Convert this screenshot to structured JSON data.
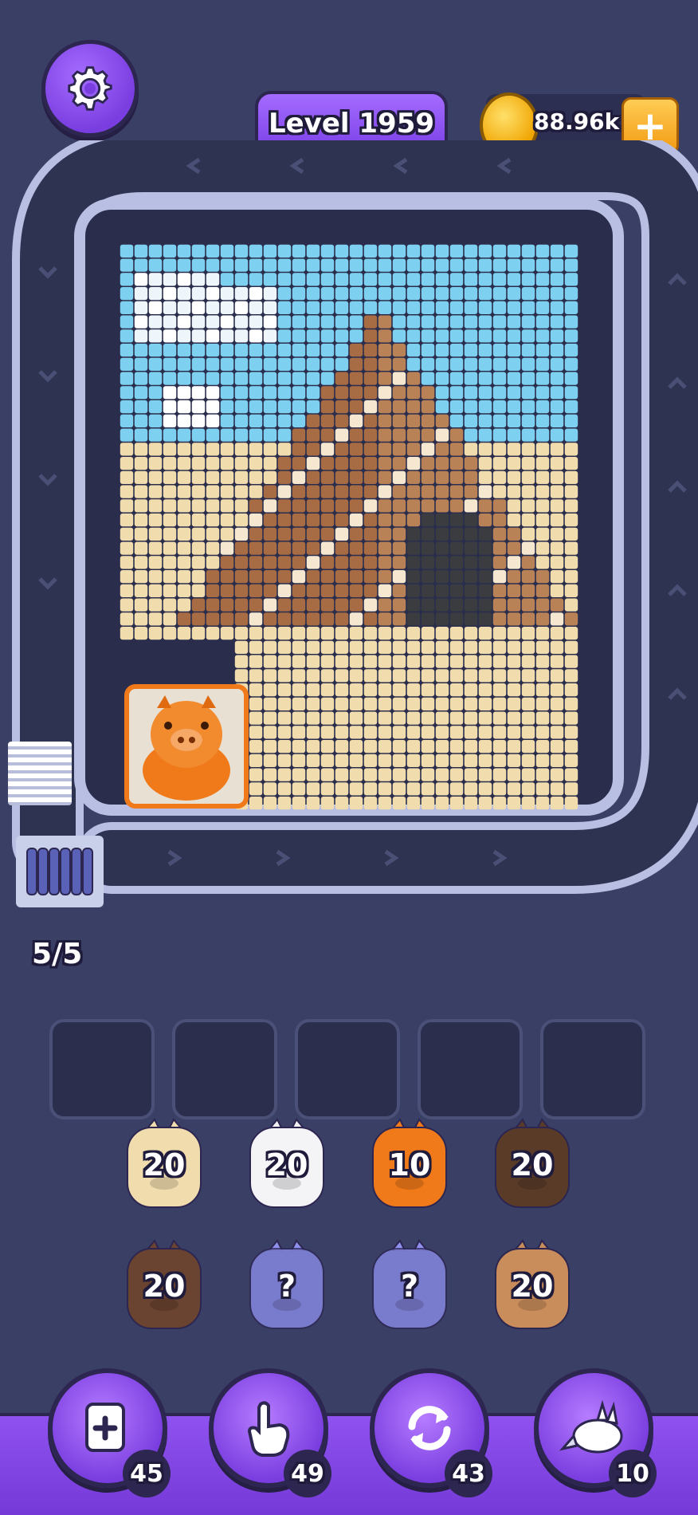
{
  "header": {
    "level_label": "Level 1959",
    "coins": "88.96k",
    "settings_icon": "gear-icon",
    "add_coins_icon": "plus-icon"
  },
  "queue": {
    "counter": "5/5"
  },
  "board": {
    "active_piece": "pig-piggybank"
  },
  "pots": [
    {
      "count": "20",
      "color": "#f1dcae"
    },
    {
      "count": "20",
      "color": "#f4f4f6"
    },
    {
      "count": "10",
      "color": "#f07a1a"
    },
    {
      "count": "20",
      "color": "#5a3b28"
    },
    {
      "count": "20",
      "color": "#6a4430"
    },
    {
      "count": "?",
      "color": "#8f90ee"
    },
    {
      "count": "?",
      "color": "#8f90ee"
    },
    {
      "count": "20",
      "color": "#c98c5b"
    }
  ],
  "powerups": [
    {
      "name": "add-slot",
      "icon": "add-slot-icon",
      "count": "45"
    },
    {
      "name": "tap-hand",
      "icon": "hand-pointer-icon",
      "count": "49"
    },
    {
      "name": "shuffle",
      "icon": "refresh-icon",
      "count": "43"
    },
    {
      "name": "rabbit-vacuum",
      "icon": "rabbit-vacuum-icon",
      "count": "10"
    }
  ],
  "colors": {
    "background": "#3a3f66",
    "accent": "#8f52f0",
    "sky": "#7ed0f0",
    "sand": "#f1dcae",
    "pyramid": "#b98256"
  }
}
